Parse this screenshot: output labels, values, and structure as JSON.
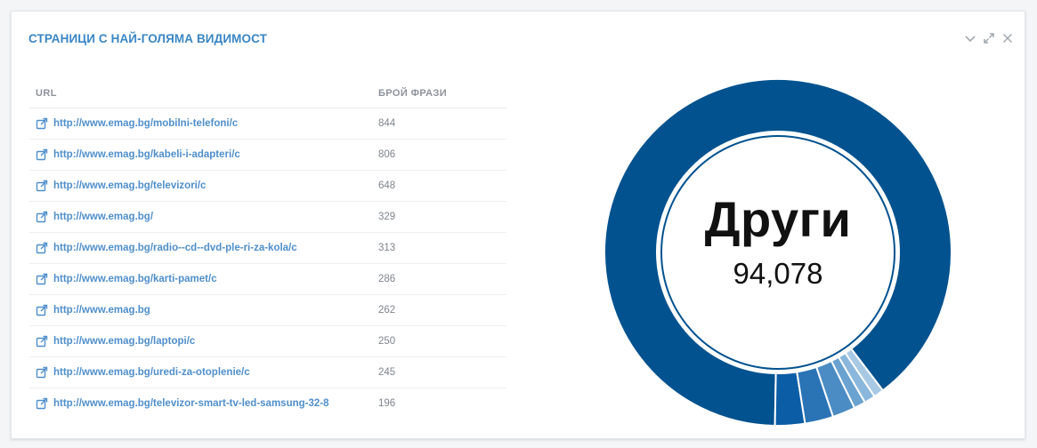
{
  "panel": {
    "title": "СТРАНИЦИ С НАЙ-ГОЛЯМА ВИДИМОСТ",
    "tools": [
      "chevron-down-icon",
      "expand-icon",
      "close-icon"
    ]
  },
  "table": {
    "headers": {
      "url": "URL",
      "count": "БРОЙ ФРАЗИ"
    },
    "rows": [
      {
        "url": "http://www.emag.bg/mobilni-telefoni/c",
        "count": "844"
      },
      {
        "url": "http://www.emag.bg/kabeli-i-adapteri/c",
        "count": "806"
      },
      {
        "url": "http://www.emag.bg/televizori/c",
        "count": "648"
      },
      {
        "url": "http://www.emag.bg/",
        "count": "329"
      },
      {
        "url": "http://www.emag.bg/radio--cd--dvd-ple-ri-za-kola/c",
        "count": "313"
      },
      {
        "url": "http://www.emag.bg/karti-pamet/c",
        "count": "286"
      },
      {
        "url": "http://www.emag.bg",
        "count": "262"
      },
      {
        "url": "http://www.emag.bg/laptopi/c",
        "count": "250"
      },
      {
        "url": "http://www.emag.bg/uredi-za-otoplenie/c",
        "count": "245"
      },
      {
        "url": "http://www.emag.bg/televizor-smart-tv-led-samsung-32-8",
        "count": "196"
      }
    ]
  },
  "donut": {
    "center_label": "Други",
    "center_value": "94,078",
    "slices": [
      {
        "value": 94078,
        "color": "#02528f"
      },
      {
        "value": 844,
        "color": "#0b5ea6"
      },
      {
        "value": 806,
        "color": "#2a74b6"
      },
      {
        "value": 648,
        "color": "#4b8cc4"
      },
      {
        "value": 329,
        "color": "#6aa2d0"
      },
      {
        "value": 313,
        "color": "#8ab7db"
      },
      {
        "value": 286,
        "color": "#a8c9e4"
      }
    ]
  }
}
